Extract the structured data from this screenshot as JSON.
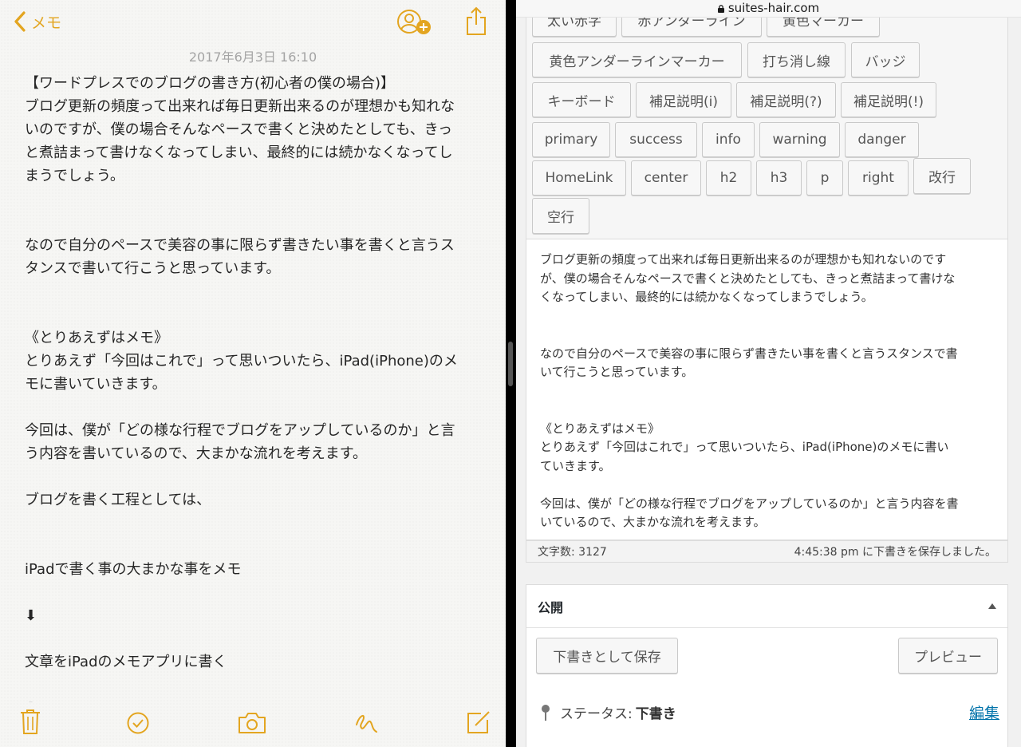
{
  "notes": {
    "back_label": "メモ",
    "date": "2017年6月3日 16:10",
    "lines": [
      "【ワードプレスでのブログの書き方(初心者の僕の場合)】",
      "ブログ更新の頻度って出来れば毎日更新出来るのが理想かも知れな",
      "いのですが、僕の場合そんなペースで書くと決めたとしても、きっ",
      "と煮詰まって書けなくなってしまい、最終的には続かなくなってし",
      "まうでしょう。",
      "",
      "",
      "なので自分のペースで美容の事に限らず書きたい事を書くと言うス",
      "タンスで書いて行こうと思っています。",
      "",
      "",
      "《とりあえずはメモ》",
      "とりあえず「今回はこれで」って思いついたら、iPad(iPhone)のメ",
      "モに書いていきます。",
      "",
      "今回は、僕が「どの様な行程でブログをアップしているのか」と言",
      "う内容を書いているので、大まかな流れを考えます。",
      "",
      "ブログを書く工程としては、",
      "",
      "",
      "iPadで書く事の大まかな事をメモ",
      "",
      "⬇",
      "",
      "文章をiPadのメモアプリに書く",
      "",
      "⬇"
    ],
    "icons": {
      "back": "chevron-left-icon",
      "add_person": "add-person-icon",
      "share": "share-icon",
      "trash": "trash-icon",
      "checklist": "checklist-icon",
      "camera": "camera-icon",
      "sketch": "sketch-icon",
      "compose": "compose-icon"
    },
    "accent": "#e3a520"
  },
  "safari": {
    "url": "suites-hair.com",
    "quicktags": {
      "row0": [
        "太い赤字",
        "赤アンダーライン",
        "黄色マーカー"
      ],
      "row1": [
        "黄色アンダーラインマーカー",
        "打ち消し線",
        "バッジ"
      ],
      "row2": [
        "キーボード",
        "補足説明(i)",
        "補足説明(?)",
        "補足説明(!)"
      ],
      "row3": [
        "primary",
        "success",
        "info",
        "warning",
        "danger"
      ],
      "row4": [
        "HomeLink",
        "center",
        "h2",
        "h3",
        "p",
        "right",
        "改行"
      ],
      "row5": [
        "空行"
      ]
    },
    "editor_lines": [
      "ブログ更新の頻度って出来れば毎日更新出来るのが理想かも知れないのです",
      "が、僕の場合そんなペースで書くと決めたとしても、きっと煮詰まって書けな",
      "くなってしまい、最終的には続かなくなってしまうでしょう。",
      "",
      "",
      "なので自分のペースで美容の事に限らず書きたい事を書くと言うスタンスで書",
      "いて行こうと思っています。",
      "",
      "",
      "《とりあえずはメモ》",
      "とりあえず「今回はこれで」って思いついたら、iPad(iPhone)のメモに書い",
      "ていきます。",
      "",
      "今回は、僕が「どの様な行程でブログをアップしているのか」と言う内容を書",
      "いているので、大まかな流れを考えます。"
    ],
    "status": {
      "word_count": "文字数: 3127",
      "saved": "4:45:38 pm に下書きを保存しました。"
    },
    "publish": {
      "title": "公開",
      "save_draft": "下書きとして保存",
      "preview": "プレビュー",
      "status_label": "ステータス:",
      "status_value": "下書き",
      "edit_link": "編集"
    }
  }
}
